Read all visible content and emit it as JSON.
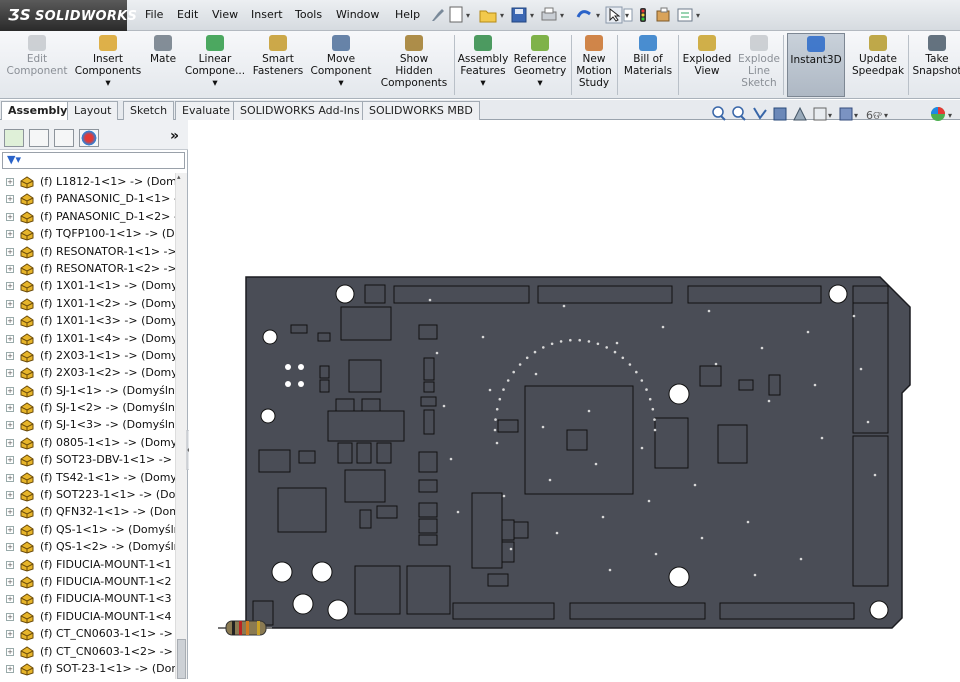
{
  "app": {
    "logo": "SOLIDWORKS"
  },
  "menu": [
    "File",
    "Edit",
    "View",
    "Insert",
    "Tools",
    "Window",
    "Help"
  ],
  "ribbon": [
    {
      "l1": "Edit",
      "l2": "Component",
      "disabled": true,
      "icon": "edit-component-icon"
    },
    {
      "l1": "Insert",
      "l2": "Components",
      "l3": "▾",
      "icon": "insert-components-icon"
    },
    {
      "l1": "Mate",
      "icon": "mate-icon"
    },
    {
      "l1": "Linear",
      "l2": "Compone...",
      "l3": "▾",
      "icon": "linear-pattern-icon"
    },
    {
      "l1": "Smart",
      "l2": "Fasteners",
      "icon": "smart-fasteners-icon"
    },
    {
      "l1": "Move",
      "l2": "Component",
      "l3": "▾",
      "icon": "move-component-icon"
    },
    {
      "l1": "Show",
      "l2": "Hidden",
      "l3": "Components",
      "icon": "show-hidden-icon"
    },
    {
      "l1": "Assembly",
      "l2": "Features",
      "l3": "▾",
      "icon": "assembly-features-icon"
    },
    {
      "l1": "Reference",
      "l2": "Geometry",
      "l3": "▾",
      "icon": "reference-geometry-icon"
    },
    {
      "l1": "New",
      "l2": "Motion",
      "l3": "Study",
      "icon": "motion-study-icon"
    },
    {
      "l1": "Bill of",
      "l2": "Materials",
      "icon": "bom-icon"
    },
    {
      "l1": "Exploded",
      "l2": "View",
      "icon": "exploded-view-icon"
    },
    {
      "l1": "Explode",
      "l2": "Line",
      "l3": "Sketch",
      "disabled": true,
      "icon": "explode-line-icon"
    },
    {
      "l1": "Instant3D",
      "active": true,
      "icon": "instant3d-icon"
    },
    {
      "l1": "Update",
      "l2": "Speedpak",
      "icon": "speedpak-icon"
    },
    {
      "l1": "Take",
      "l2": "Snapshot",
      "icon": "snapshot-icon"
    }
  ],
  "tabs": [
    "Assembly",
    "Layout",
    "Sketch",
    "Evaluate",
    "SOLIDWORKS Add-Ins",
    "SOLIDWORKS MBD"
  ],
  "active_tab": "Assembly",
  "tree": [
    "(f) L1812-1<1> -> (Domy",
    "(f) PANASONIC_D-1<1> -",
    "(f) PANASONIC_D-1<2> -",
    "(f) TQFP100-1<1> -> (Do",
    "(f) RESONATOR-1<1> ->",
    "(f) RESONATOR-1<2> ->",
    "(f) 1X01-1<1> -> (Domyśl",
    "(f) 1X01-1<2> -> (Domyśl",
    "(f) 1X01-1<3> -> (Domyśl",
    "(f) 1X01-1<4> -> (Domyśl",
    "(f) 2X03-1<1> -> (Domyśl",
    "(f) 2X03-1<2> -> (Domyśl",
    "(f) SJ-1<1> -> (Domyślna",
    "(f) SJ-1<2> -> (Domyślna",
    "(f) SJ-1<3> -> (Domyślna",
    "(f) 0805-1<1> -> (Domyśl",
    "(f) SOT23-DBV-1<1> -> (I",
    "(f) TS42-1<1> -> (Domyśl",
    "(f) SOT223-1<1> -> (Dom",
    "(f) QFN32-1<1> -> (Dom",
    "(f) QS-1<1> -> (Domyśln",
    "(f) QS-1<2> -> (Domyśln",
    "(f) FIDUCIA-MOUNT-1<1",
    "(f) FIDUCIA-MOUNT-1<2",
    "(f) FIDUCIA-MOUNT-1<3",
    "(f) FIDUCIA-MOUNT-1<4",
    "(f) CT_CN0603-1<1> -> (I",
    "(f) CT_CN0603-1<2> -> (I",
    "(f) SOT-23-1<1> -> (Dom"
  ],
  "colors": {
    "board": "#4a4d56",
    "board_edge": "#1b1c20",
    "part_icon": "#e7b52a"
  }
}
